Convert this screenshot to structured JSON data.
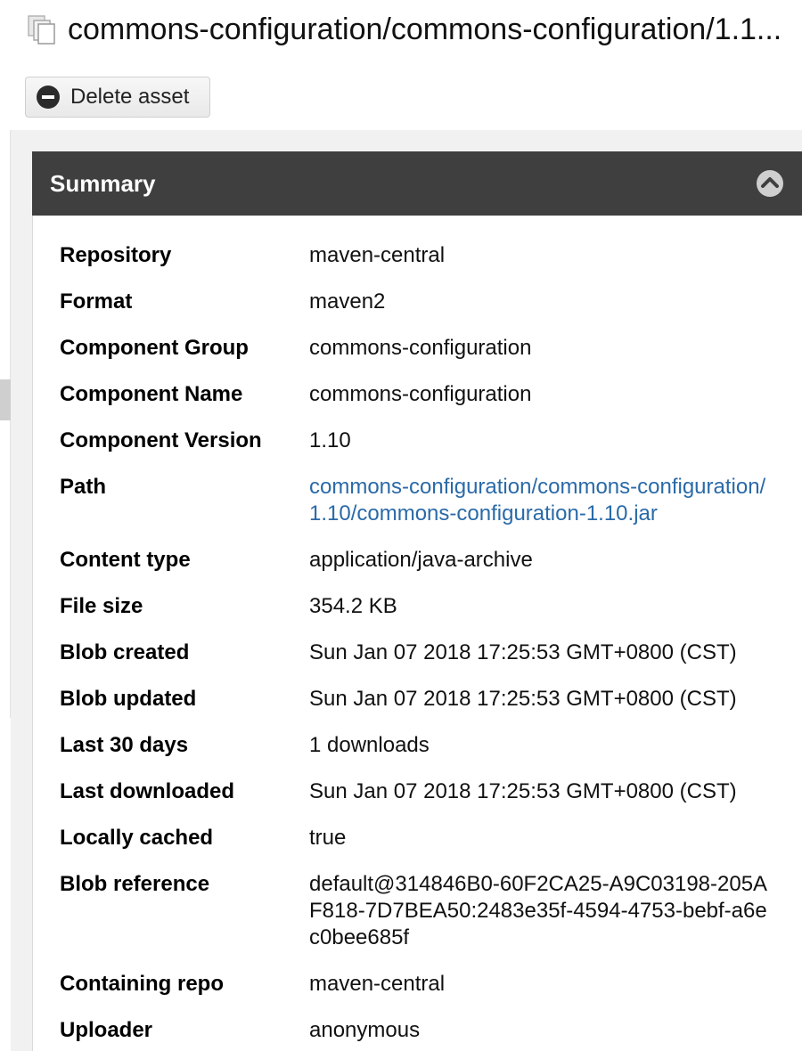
{
  "header": {
    "title": "commons-configuration/commons-configuration/1.1...",
    "title_icon": "documents-icon"
  },
  "toolbar": {
    "delete_label": "Delete asset",
    "delete_icon": "minus-circle-icon"
  },
  "summary": {
    "title": "Summary",
    "collapse_icon": "chevron-up-icon",
    "rows": [
      {
        "label": "Repository",
        "value": "maven-central"
      },
      {
        "label": "Format",
        "value": "maven2"
      },
      {
        "label": "Component Group",
        "value": "commons-configuration"
      },
      {
        "label": "Component Name",
        "value": "commons-configuration"
      },
      {
        "label": "Component Version",
        "value": "1.10"
      },
      {
        "label": "Path",
        "value": "commons-configuration/commons-configuration/1.10/commons-configuration-1.10.jar"
      },
      {
        "label": "Content type",
        "value": "application/java-archive"
      },
      {
        "label": "File size",
        "value": "354.2 KB"
      },
      {
        "label": "Blob created",
        "value": "Sun Jan 07 2018 17:25:53 GMT+0800 (CST)"
      },
      {
        "label": "Blob updated",
        "value": "Sun Jan 07 2018 17:25:53 GMT+0800 (CST)"
      },
      {
        "label": "Last 30 days",
        "value": "1 downloads"
      },
      {
        "label": "Last downloaded",
        "value": "Sun Jan 07 2018 17:25:53 GMT+0800 (CST)"
      },
      {
        "label": "Locally cached",
        "value": "true"
      },
      {
        "label": "Blob reference",
        "value": "default@314846B0-60F2CA25-A9C03198-205AF818-7D7BEA50:2483e35f-4594-4753-bebf-a6ec0bee685f"
      },
      {
        "label": "Containing repo",
        "value": "maven-central"
      },
      {
        "label": "Uploader",
        "value": "anonymous"
      }
    ]
  },
  "colors": {
    "header_bg": "#3f3f3f",
    "link": "#2a6aa8",
    "panel_bg": "#f1f1f1"
  }
}
